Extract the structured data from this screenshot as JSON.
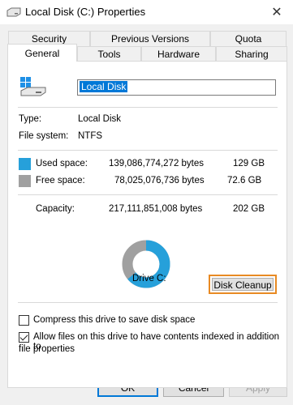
{
  "window": {
    "title": "Local Disk (C:) Properties"
  },
  "tabs_row1": [
    {
      "label": "Security"
    },
    {
      "label": "Previous Versions"
    },
    {
      "label": "Quota"
    }
  ],
  "tabs_row2": [
    {
      "label": "General",
      "active": true
    },
    {
      "label": "Tools"
    },
    {
      "label": "Hardware"
    },
    {
      "label": "Sharing"
    }
  ],
  "general": {
    "name_value": "Local Disk",
    "type_label": "Type:",
    "type_value": "Local Disk",
    "fs_label": "File system:",
    "fs_value": "NTFS",
    "used_label": "Used space:",
    "used_bytes": "139,086,774,272 bytes",
    "used_gb": "129 GB",
    "free_label": "Free space:",
    "free_bytes": "78,025,076,736 bytes",
    "free_gb": "72.6 GB",
    "capacity_label": "Capacity:",
    "capacity_bytes": "217,111,851,008 bytes",
    "capacity_gb": "202 GB",
    "drive_label": "Drive C:",
    "cleanup_label": "Disk Cleanup",
    "compress_label": "Compress this drive to save disk space",
    "compress_checked": false,
    "index_label_line1": "Allow files on this drive to have contents indexed in addition to",
    "index_label_line2": "file properties",
    "index_checked": true,
    "used_fraction": 0.64,
    "colors": {
      "used": "#26a0da",
      "free": "#a0a0a0"
    }
  },
  "footer": {
    "ok": "OK",
    "cancel": "Cancel",
    "apply": "Apply"
  }
}
